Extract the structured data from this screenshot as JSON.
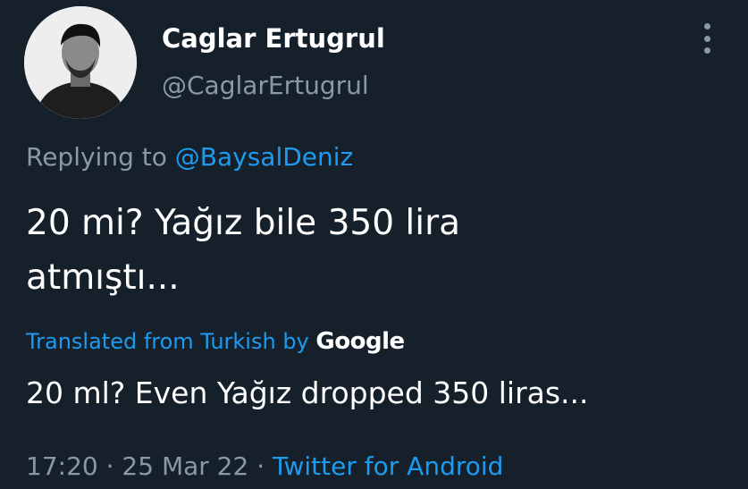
{
  "author": {
    "display_name": "Caglar Ertugrul",
    "handle": "@CaglarErtugrul"
  },
  "more_icon": "more-vertical-icon",
  "reply": {
    "prefix": "Replying to",
    "mention": "@BaysalDeniz"
  },
  "tweet": {
    "line1": "20 mi? Yağız bile 350 lira",
    "line2": "atmıştı..."
  },
  "translation": {
    "label": "Translated from Turkish by",
    "provider": "Google",
    "text": "20 ml? Even Yağız dropped 350 liras..."
  },
  "meta": {
    "time": "17:20",
    "separator": "·",
    "date": "25 Mar 22",
    "source": "Twitter for Android"
  },
  "colors": {
    "background": "#15202b",
    "text": "#ffffff",
    "muted": "#8b98a5",
    "accent": "#1d9bf0"
  }
}
